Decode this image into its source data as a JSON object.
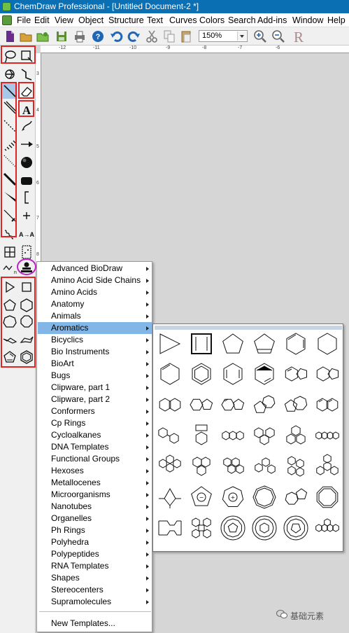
{
  "titlebar": {
    "title": "ChemDraw Professional - [Untitled Document-2 *]"
  },
  "menubar": {
    "items": [
      "File",
      "Edit",
      "View",
      "Object",
      "Structure",
      "Text",
      "Curves",
      "Colors",
      "Search",
      "Add-ins",
      "Window",
      "Help"
    ]
  },
  "toolbar": {
    "zoom_value": "150%",
    "icons": [
      "new-document-icon",
      "open-icon",
      "open-templates-icon",
      "save-icon",
      "print-icon",
      "help-icon",
      "undo-icon",
      "redo-icon",
      "cut-icon",
      "copy-icon",
      "paste-icon",
      "zoom-in-icon",
      "zoom-out-icon",
      "chemdraw-r-icon"
    ]
  },
  "ruler": {
    "h_labels": [
      "-12",
      "-11",
      "-10",
      "-9",
      "-8",
      "-7",
      "-6"
    ],
    "v_labels": [
      "3",
      "4",
      "5",
      "6",
      "7",
      "8"
    ]
  },
  "submenu": {
    "items": [
      "Advanced BioDraw",
      "Amino Acid Side Chains",
      "Amino Acids",
      "Anatomy",
      "Animals",
      "Aromatics",
      "Bicyclics",
      "Bio Instruments",
      "BioArt",
      "Bugs",
      "Clipware, part 1",
      "Clipware, part 2",
      "Conformers",
      "Cp Rings",
      "Cycloalkanes",
      "DNA Templates",
      "Functional Groups",
      "Hexoses",
      "Metallocenes",
      "Microorganisms",
      "Nanotubes",
      "Organelles",
      "Ph Rings",
      "Polyhedra",
      "Polypeptides",
      "RNA Templates",
      "Shapes",
      "Stereocenters",
      "Supramolecules"
    ],
    "selected": "Aromatics",
    "footer": "New Templates..."
  },
  "watermark": {
    "text": "基础元素"
  },
  "colors": {
    "titlebar": "#0b6fb3",
    "selection": "#82b6e6",
    "highlight_red": "#e02424",
    "highlight_magenta": "#c020c8"
  }
}
